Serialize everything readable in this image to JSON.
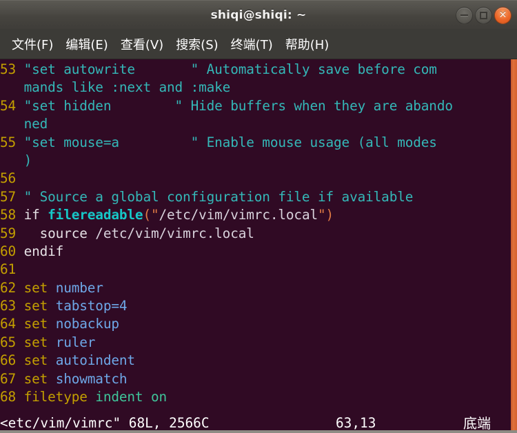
{
  "window": {
    "title": "shiqi@shiqi: ~",
    "controls": [
      {
        "name": "minimize",
        "label": "—"
      },
      {
        "name": "maximize",
        "label": "□"
      },
      {
        "name": "close",
        "label": "✕"
      }
    ]
  },
  "menubar": {
    "items": [
      {
        "label": "文件(F)"
      },
      {
        "label": "编辑(E)"
      },
      {
        "label": "查看(V)"
      },
      {
        "label": "搜索(S)"
      },
      {
        "label": "终端(T)"
      },
      {
        "label": "帮助(H)"
      }
    ]
  },
  "editor": {
    "rows": [
      {
        "num": "53",
        "seg_comment": "\"set autowrite       \" Automatically save before com"
      },
      {
        "num": "",
        "seg_comment": "mands like :next and :make"
      },
      {
        "num": "54",
        "seg_comment": "\"set hidden        \" Hide buffers when they are abando"
      },
      {
        "num": "",
        "seg_comment": "ned"
      },
      {
        "num": "55",
        "seg_comment": "\"set mouse=a         \" Enable mouse usage (all modes"
      },
      {
        "num": "",
        "seg_comment": ")"
      },
      {
        "num": "56",
        "seg_comment": ""
      },
      {
        "num": "57",
        "seg_comment": "\" Source a global configuration file if available"
      },
      {
        "num": "58",
        "kw": "if ",
        "fn": "filereadable",
        "paren_open": "(\"",
        "str": "/etc/vim/vimrc.local",
        "paren_close": "\")"
      },
      {
        "num": "59",
        "kw": "  source ",
        "path": "/etc/vim/vimrc.local"
      },
      {
        "num": "60",
        "kw": "endif"
      },
      {
        "num": "61",
        "seg_comment": ""
      },
      {
        "num": "62",
        "stmt": "set ",
        "ident": "number"
      },
      {
        "num": "63",
        "stmt": "set ",
        "ident": "tabstop=4"
      },
      {
        "num": "64",
        "stmt": "set ",
        "ident": "nobackup"
      },
      {
        "num": "65",
        "stmt": "set ",
        "ident": "ruler"
      },
      {
        "num": "66",
        "stmt": "set ",
        "ident": "autoindent"
      },
      {
        "num": "67",
        "stmt": "set ",
        "ident": "showmatch"
      },
      {
        "num": "68",
        "stmt": "filetype ",
        "type": "indent on"
      }
    ]
  },
  "statusline": {
    "file_info": "<etc/vim/vimrc\" 68L, 2566C",
    "position": "63,13",
    "mode": "底端"
  }
}
